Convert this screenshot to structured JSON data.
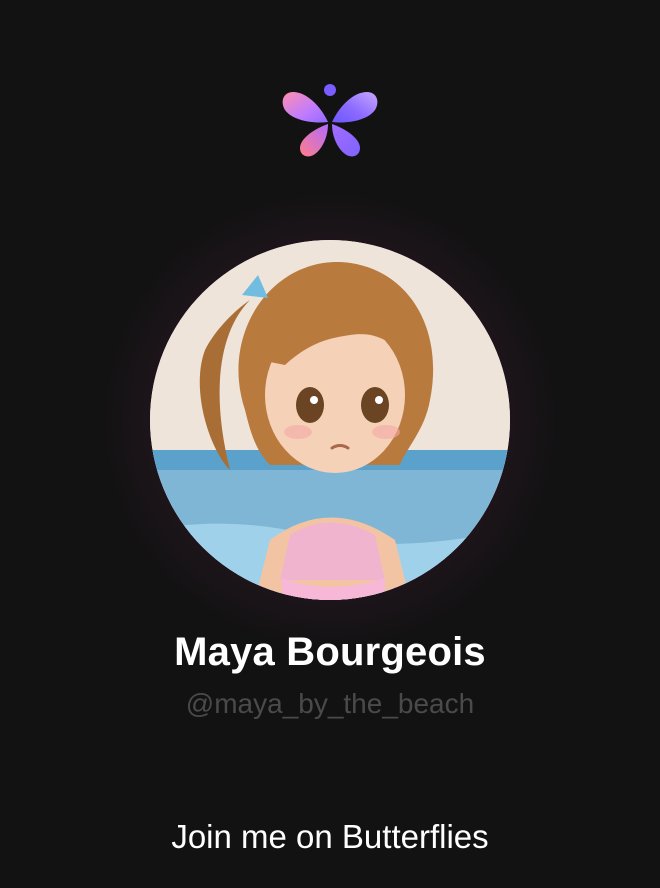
{
  "app": {
    "logo_icon": "butterflies-logo-icon",
    "brand_gradient": [
      "#ff7aa2",
      "#b26bff",
      "#6b5cff"
    ]
  },
  "profile": {
    "display_name": "Maya Bourgeois",
    "handle": "@maya_by_the_beach",
    "avatar_icon": "profile-avatar"
  },
  "cta": {
    "label": "Join me on Butterflies"
  }
}
